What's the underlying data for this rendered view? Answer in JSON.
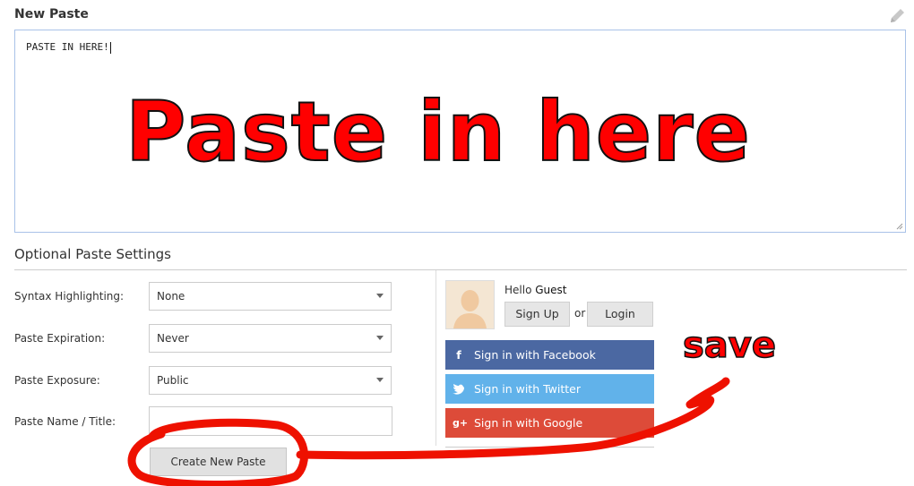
{
  "header": {
    "title": "New Paste",
    "edit_icon": "pencil-icon"
  },
  "paste": {
    "content": "PASTE IN HERE!"
  },
  "annotations": {
    "main": "Paste in here",
    "save": "save",
    "color": "#ff0000"
  },
  "settings": {
    "title": "Optional Paste Settings",
    "syntax": {
      "label": "Syntax Highlighting:",
      "value": "None"
    },
    "expiration": {
      "label": "Paste Expiration:",
      "value": "Never"
    },
    "exposure": {
      "label": "Paste Exposure:",
      "value": "Public"
    },
    "name": {
      "label": "Paste Name / Title:",
      "value": ""
    },
    "create_button": "Create New Paste"
  },
  "account": {
    "hello": "Hello",
    "user": "Guest",
    "signup": "Sign Up",
    "or": "or",
    "login": "Login",
    "facebook": {
      "label": "Sign in with Facebook",
      "icon": "f",
      "color": "#4b68a2"
    },
    "twitter": {
      "label": "Sign in with Twitter",
      "icon": "twitter-bird",
      "color": "#61b2ea"
    },
    "google": {
      "label": "Sign in with Google",
      "icon": "g+",
      "color": "#dd4b39"
    }
  }
}
